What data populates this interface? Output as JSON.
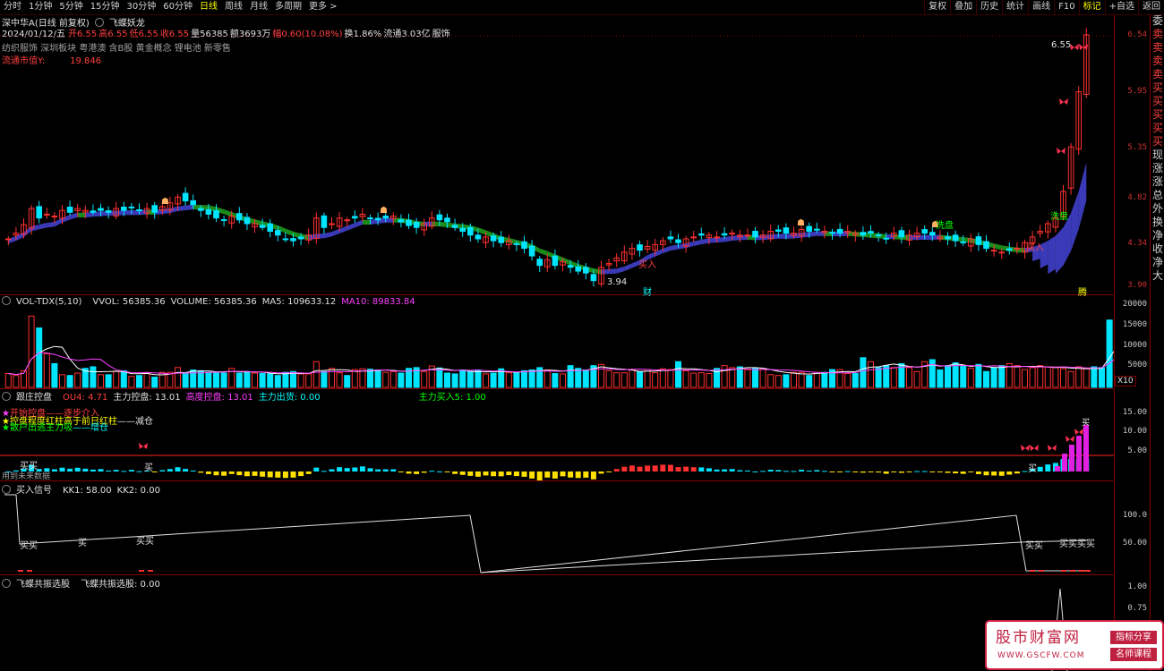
{
  "toolbar": {
    "left_items": [
      "分时",
      "1分钟",
      "5分钟",
      "15分钟",
      "30分钟",
      "60分钟",
      "日线",
      "周线",
      "月线",
      "多周期",
      "更多 >"
    ],
    "active_index": 6,
    "right_items": [
      "复权",
      "叠加",
      "历史",
      "统计",
      "画线",
      "F10",
      "标记",
      "+自选",
      "返回"
    ]
  },
  "main_panel": {
    "stock_title": "深中华A(日线 前复权)",
    "indicator_name": "飞蝶妖龙",
    "quote_date": "2024/01/12/五",
    "open": "开6.55",
    "high": "高6.55",
    "low": "低6.55",
    "close": "收6.55",
    "volume": "量56385",
    "amount": "额3693万",
    "change": "幅0.60(10.08%)",
    "turnover": "换1.86%",
    "float_cap": "流通3.03亿",
    "industry": "服饰",
    "concepts": "纺织服饰 深圳板块 粤港澳 含B股 黄金概念 锂电池 新零售",
    "mv_label": "流通市值Y:",
    "mv_value": "19.846",
    "price_high_label": "6.55",
    "price_low_label": "3.94",
    "annot_xipan_1": "洗盘",
    "annot_xipan_2": "洗盘",
    "annot_buy_1": "买入",
    "annot_buy_2": "买入",
    "annot_cai": "财",
    "annot_teng": "腾",
    "y_axis": [
      "6.54",
      "5.95",
      "5.35",
      "4.82",
      "4.34",
      "3.90"
    ]
  },
  "volume_panel": {
    "name": "VOL-TDX(5,10)",
    "vvol": "VVOL: 56385.36",
    "volume": "VOLUME: 56385.36",
    "ma5": "MA5: 109633.12",
    "ma10": "MA10: 89833.84",
    "y_axis": [
      "20000",
      "15000",
      "10000",
      "5000"
    ],
    "unit": "X10",
    "right_cut": [
      "14",
      "14",
      "14"
    ]
  },
  "control_panel": {
    "name": "跟庄控盘",
    "ou4": "OU4: 4.71",
    "main_control": "主力控盘: 13.01",
    "high_control": "高度控盘: 13.01",
    "main_out": "主力出货: 0.00",
    "main_buy5": "主力买入5: 1.00",
    "legend_1": "开始控盘",
    "legend_2": "逐步介入",
    "legend_3": "控盘程度红柱高于前日红柱",
    "legend_4": "减仓",
    "legend_5": "散户出逃主力吸",
    "legend_6": "增仓",
    "bottom_note": "用到未来数据",
    "buy_marks": [
      "买买",
      "买",
      "买"
    ],
    "y_axis": [
      "15.00",
      "10.00",
      "5.00"
    ]
  },
  "signal_panel": {
    "name": "买入信号",
    "kk1": "KK1: 58.00",
    "kk2": "KK2: 0.00",
    "marks": [
      "买买",
      "买",
      "买买",
      "买买",
      "买买买买"
    ],
    "y_axis": [
      "100.0",
      "50.00"
    ]
  },
  "resonance_panel": {
    "name": "飞蝶共振选股",
    "value": "飞蝶共振选股: 0.00",
    "y_axis": [
      "1.00",
      "0.75"
    ]
  },
  "sidebar_chars": [
    "委",
    "卖",
    "卖",
    "卖",
    "卖",
    "买",
    "买",
    "买",
    "买",
    "买",
    "现",
    "涨",
    "涨",
    "总",
    "外",
    "换",
    "净",
    "收",
    "净",
    "大"
  ],
  "watermark": {
    "title": "股市财富网",
    "url": "WWW.GSCFW.COM",
    "tag1": "指标分享",
    "tag2": "名师课程"
  },
  "colors": {
    "up": "#ff3030",
    "down": "#00e5ff",
    "ribbon_up": "#3a3ab8",
    "ribbon_down": "#1a8a1a",
    "grid": "#800000"
  },
  "chart_data": {
    "type": "candlestick",
    "title": "深中华A(日线 前复权)",
    "ylim": [
      3.9,
      6.54
    ],
    "y_ticks": [
      6.54,
      5.95,
      5.35,
      4.82,
      4.34,
      3.9
    ],
    "highest": 6.55,
    "lowest": 3.94,
    "close": [
      4.4,
      4.46,
      4.55,
      4.72,
      4.62,
      4.66,
      4.64,
      4.7,
      4.68,
      4.72,
      4.7,
      4.68,
      4.7,
      4.68,
      4.72,
      4.7,
      4.73,
      4.7,
      4.72,
      4.68,
      4.74,
      4.78,
      4.84,
      4.8,
      4.76,
      4.7,
      4.66,
      4.62,
      4.6,
      4.64,
      4.6,
      4.56,
      4.56,
      4.52,
      4.48,
      4.44,
      4.4,
      4.38,
      4.4,
      4.44,
      4.62,
      4.52,
      4.56,
      4.62,
      4.6,
      4.62,
      4.66,
      4.62,
      4.6,
      4.62,
      4.64,
      4.58,
      4.54,
      4.52,
      4.56,
      4.62,
      4.6,
      4.58,
      4.52,
      4.48,
      4.44,
      4.4,
      4.42,
      4.38,
      4.36,
      4.38,
      4.34,
      4.3,
      4.22,
      4.12,
      4.18,
      4.12,
      4.16,
      4.1,
      4.06,
      4.04,
      3.96,
      4.1,
      4.14,
      4.2,
      4.26,
      4.3,
      4.28,
      4.32,
      4.34,
      4.38,
      4.4,
      4.36,
      4.4,
      4.42,
      4.44,
      4.44,
      4.42,
      4.44,
      4.46,
      4.44,
      4.44,
      4.42,
      4.44,
      4.48,
      4.48,
      4.46,
      4.46,
      4.5,
      4.48,
      4.5,
      4.48,
      4.46,
      4.46,
      4.48,
      4.46,
      4.44,
      4.46,
      4.44,
      4.4,
      4.46,
      4.42,
      4.44,
      4.46,
      4.46,
      4.44,
      4.42,
      4.4,
      4.38,
      4.36,
      4.4,
      4.34,
      4.3,
      4.28,
      4.26,
      4.28,
      4.3,
      4.36,
      4.42,
      4.48,
      4.56,
      4.62,
      4.9,
      5.37,
      5.95,
      6.55
    ],
    "volume_x10": [
      3500,
      3000,
      4200,
      18000,
      15000,
      8500,
      6000,
      3200,
      3000,
      3600,
      4800,
      5200,
      3200,
      3200,
      4000,
      4200,
      2800,
      3000,
      3600,
      2600,
      3800,
      3800,
      5000,
      3400,
      4400,
      4200,
      3800,
      3800,
      3600,
      4800,
      3600,
      3800,
      3600,
      3500,
      3400,
      3000,
      3800,
      4000,
      3400,
      3400,
      6500,
      4000,
      4800,
      3700,
      3000,
      4500,
      4700,
      4600,
      4400,
      3800,
      4000,
      3600,
      4800,
      5000,
      4000,
      5400,
      4900,
      3600,
      3400,
      4400,
      4000,
      4400,
      3400,
      3600,
      4700,
      3700,
      3700,
      4200,
      4400,
      5000,
      4400,
      3500,
      3400,
      5500,
      4800,
      4400,
      5500,
      5800,
      4200,
      3700,
      3700,
      4500,
      4000,
      4500,
      3700,
      4700,
      4500,
      6500,
      4200,
      3600,
      3700,
      3500,
      4800,
      5500,
      5000,
      5200,
      4500,
      4800,
      4800,
      3200,
      3000,
      3200,
      3800,
      3800,
      3000,
      3800,
      3800,
      4500,
      4500,
      3500,
      3500,
      7500,
      6500,
      5000,
      5500,
      5000,
      6000,
      5000,
      4000,
      6500,
      7000,
      4400,
      5500,
      6200,
      5500,
      4800,
      5800,
      4000,
      5000,
      5500,
      6000,
      5500,
      4500,
      5000,
      5500,
      5200,
      5000,
      4700,
      4000,
      5200,
      4700,
      5200,
      5000,
      17000,
      19500,
      6000
    ]
  }
}
